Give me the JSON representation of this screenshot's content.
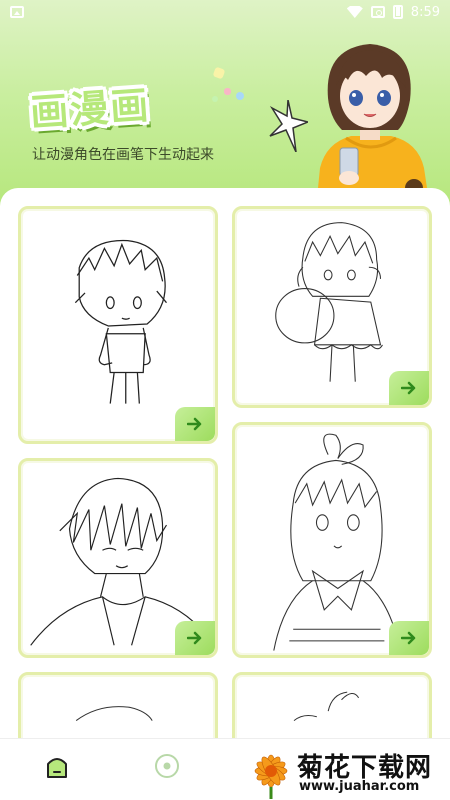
{
  "status_bar": {
    "time": "8:59",
    "icons": [
      "gallery-icon",
      "wifi-icon",
      "signal-icon",
      "battery-icon"
    ]
  },
  "header": {
    "title": "画漫画",
    "subtitle": "让动漫角色在画笔下生动起来",
    "colors": {
      "gradient_top": "#dff3c6",
      "gradient_bottom": "#b6e77c",
      "title_fill": "#b6e87a"
    }
  },
  "cards": [
    {
      "subject": "chibi-boy-sketch",
      "action_icon": "arrow-right-icon"
    },
    {
      "subject": "chibi-girl-with-plush-sketch",
      "action_icon": "arrow-right-icon"
    },
    {
      "subject": "boy-portrait-sketch",
      "action_icon": "arrow-right-icon"
    },
    {
      "subject": "girl-with-bow-sketch",
      "action_icon": "arrow-right-icon"
    },
    {
      "subject": "partial-sketch-1",
      "action_icon": "arrow-right-icon"
    },
    {
      "subject": "partial-sketch-2",
      "action_icon": "arrow-right-icon"
    }
  ],
  "bottom_nav": {
    "items": [
      {
        "icon": "home-icon",
        "active": true
      },
      {
        "icon": "discover-icon",
        "active": false
      }
    ]
  },
  "watermark": {
    "brand": "菊花下载网",
    "url": "www.juahar.com"
  },
  "accent_color": "#9ddc5d"
}
